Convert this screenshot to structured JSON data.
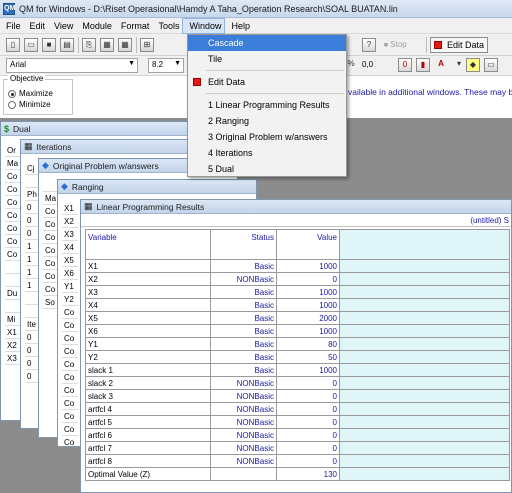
{
  "window": {
    "title": "QM for Windows - D:\\Riset Operasional\\Hamdy A Taha_Operation Research\\SOAL BUATAN.lin",
    "app_icon": "QM"
  },
  "menubar": [
    "File",
    "Edit",
    "View",
    "Module",
    "Format",
    "Tools",
    "Window",
    "Help"
  ],
  "window_menu": {
    "items": [
      {
        "label": "Cascade",
        "highlighted": true
      },
      {
        "label": "Tile"
      },
      {
        "label": "Edit Data",
        "icon": "red-square-icon"
      },
      {
        "label": "1 Linear Programming Results"
      },
      {
        "label": "2 Ranging"
      },
      {
        "label": "3 Original Problem w/answers"
      },
      {
        "label": "4 Iterations"
      },
      {
        "label": "5 Dual"
      }
    ]
  },
  "toolbar": {
    "font_name": "Arial",
    "font_size": "8.2",
    "stop_label": "Stop",
    "edit_data_label": "Edit Data",
    "decimal_label": "0,0"
  },
  "objective": {
    "legend": "Objective",
    "options": [
      "Maximize",
      "Minimize"
    ],
    "selected": "Maximize"
  },
  "info_text": "vailable in additional windows. These may be",
  "windows": {
    "dual": "Dual",
    "iterations": "Iterations",
    "original": "Original Problem w/answers",
    "ranging": "Ranging",
    "lp": "Linear Programming Results"
  },
  "lp_results": {
    "subtitle": "(untitled) S",
    "headers": [
      "Variable",
      "Status",
      "Value"
    ],
    "rows": [
      [
        "X1",
        "Basic",
        "1000"
      ],
      [
        "X2",
        "NONBasic",
        "0"
      ],
      [
        "X3",
        "Basic",
        "1000"
      ],
      [
        "X4",
        "Basic",
        "1000"
      ],
      [
        "X5",
        "Basic",
        "2000"
      ],
      [
        "X6",
        "Basic",
        "1000"
      ],
      [
        "Y1",
        "Basic",
        "80"
      ],
      [
        "Y2",
        "Basic",
        "50"
      ],
      [
        "slack 1",
        "Basic",
        "1000"
      ],
      [
        "slack 2",
        "NONBasic",
        "0"
      ],
      [
        "slack 3",
        "NONBasic",
        "0"
      ],
      [
        "artfcl 4",
        "NONBasic",
        "0"
      ],
      [
        "artfcl 5",
        "NONBasic",
        "0"
      ],
      [
        "artfcl 6",
        "NONBasic",
        "0"
      ],
      [
        "artfcl 7",
        "NONBasic",
        "0"
      ],
      [
        "artfcl 8",
        "NONBasic",
        "0"
      ],
      [
        "Optimal Value (Z)",
        "",
        "130"
      ]
    ]
  },
  "stubs": {
    "dual_col": [
      "Or",
      "Ma",
      "Co",
      "Co",
      "Co",
      "Co",
      "Co",
      "Co",
      "Co",
      "",
      "",
      "Du",
      "",
      "Mi",
      "X1",
      "X2",
      "X3"
    ],
    "iter_col": [
      "Cj",
      "",
      "Ph",
      "0",
      "0",
      "0",
      "1",
      "1",
      "1",
      "1",
      "",
      "",
      "Ite",
      "0",
      "0",
      "0",
      "0"
    ],
    "orig_col": [
      "",
      "Ma",
      "Co",
      "Co",
      "Co",
      "Co",
      "Co",
      "Co",
      "Co",
      "So"
    ],
    "rang_col": [
      "X1",
      "X2",
      "X3",
      "X4",
      "X5",
      "X6",
      "Y1",
      "Y2",
      "Co",
      "Co",
      "Co",
      "Co",
      "Co",
      "Co",
      "Co",
      "Co",
      "Co",
      "Co",
      "Co",
      "Co"
    ]
  }
}
